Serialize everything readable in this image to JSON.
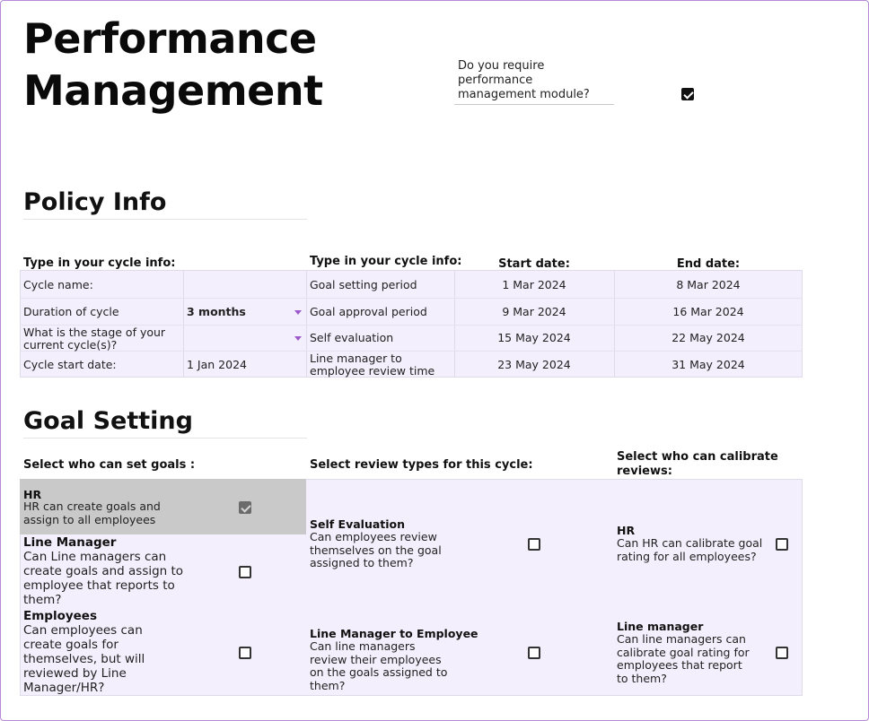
{
  "page": {
    "title": "Performance\nManagement",
    "module_question": "Do you require performance management module?",
    "module_enabled": true
  },
  "policy": {
    "section_title": "Policy Info",
    "left_header": "Type in your cycle info:",
    "right_header": "Type in your cycle info:",
    "col_start": "Start date:",
    "col_end": "End date:",
    "fields": [
      {
        "label": "Cycle name:",
        "value": ""
      },
      {
        "label": "Duration of cycle",
        "value": "3 months",
        "dropdown": true
      },
      {
        "label": "What is the stage of your current cycle(s)?",
        "value": "",
        "dropdown": true
      },
      {
        "label": "Cycle start date:",
        "value": "1 Jan 2024"
      }
    ],
    "periods": [
      {
        "name": "Goal setting period",
        "start": "1 Mar 2024",
        "end": "8 Mar 2024"
      },
      {
        "name": "Goal approval period",
        "start": "9 Mar 2024",
        "end": "16 Mar 2024"
      },
      {
        "name": "Self evaluation",
        "start": "15 May 2024",
        "end": "22 May 2024"
      },
      {
        "name": "Line manager to employee review time",
        "start": "23 May 2024",
        "end": "31 May 2024"
      }
    ]
  },
  "goals": {
    "section_title": "Goal Setting",
    "who_header": "Select who can set goals :",
    "review_header": "Select review types for this cycle:",
    "calibrate_header": "Select who can calibrate reviews:",
    "who": [
      {
        "title": "HR",
        "desc": "HR can create goals and assign to all employees",
        "checked": true
      },
      {
        "title": "Line Manager",
        "desc": "Can Line managers can create goals and assign to employee that reports to them?",
        "checked": false
      },
      {
        "title": "Employees",
        "desc": "Can employees can create goals for themselves, but will reviewed by Line Manager/HR?",
        "checked": false
      }
    ],
    "review_types": [
      {
        "title": "Self Evaluation",
        "desc": "Can employees review themselves on the goal assigned to them?",
        "checked": false
      },
      {
        "title": "Line Manager to Employee",
        "desc": "Can line managers review their employees on the goals assigned to them?",
        "checked": false
      }
    ],
    "calibrators": [
      {
        "title": "HR",
        "desc": "Can HR can calibrate goal rating for all employees?",
        "checked": false
      },
      {
        "title": "Line manager",
        "desc": "Can line managers can calibrate goal rating for employees that report to them?",
        "checked": false
      }
    ]
  }
}
